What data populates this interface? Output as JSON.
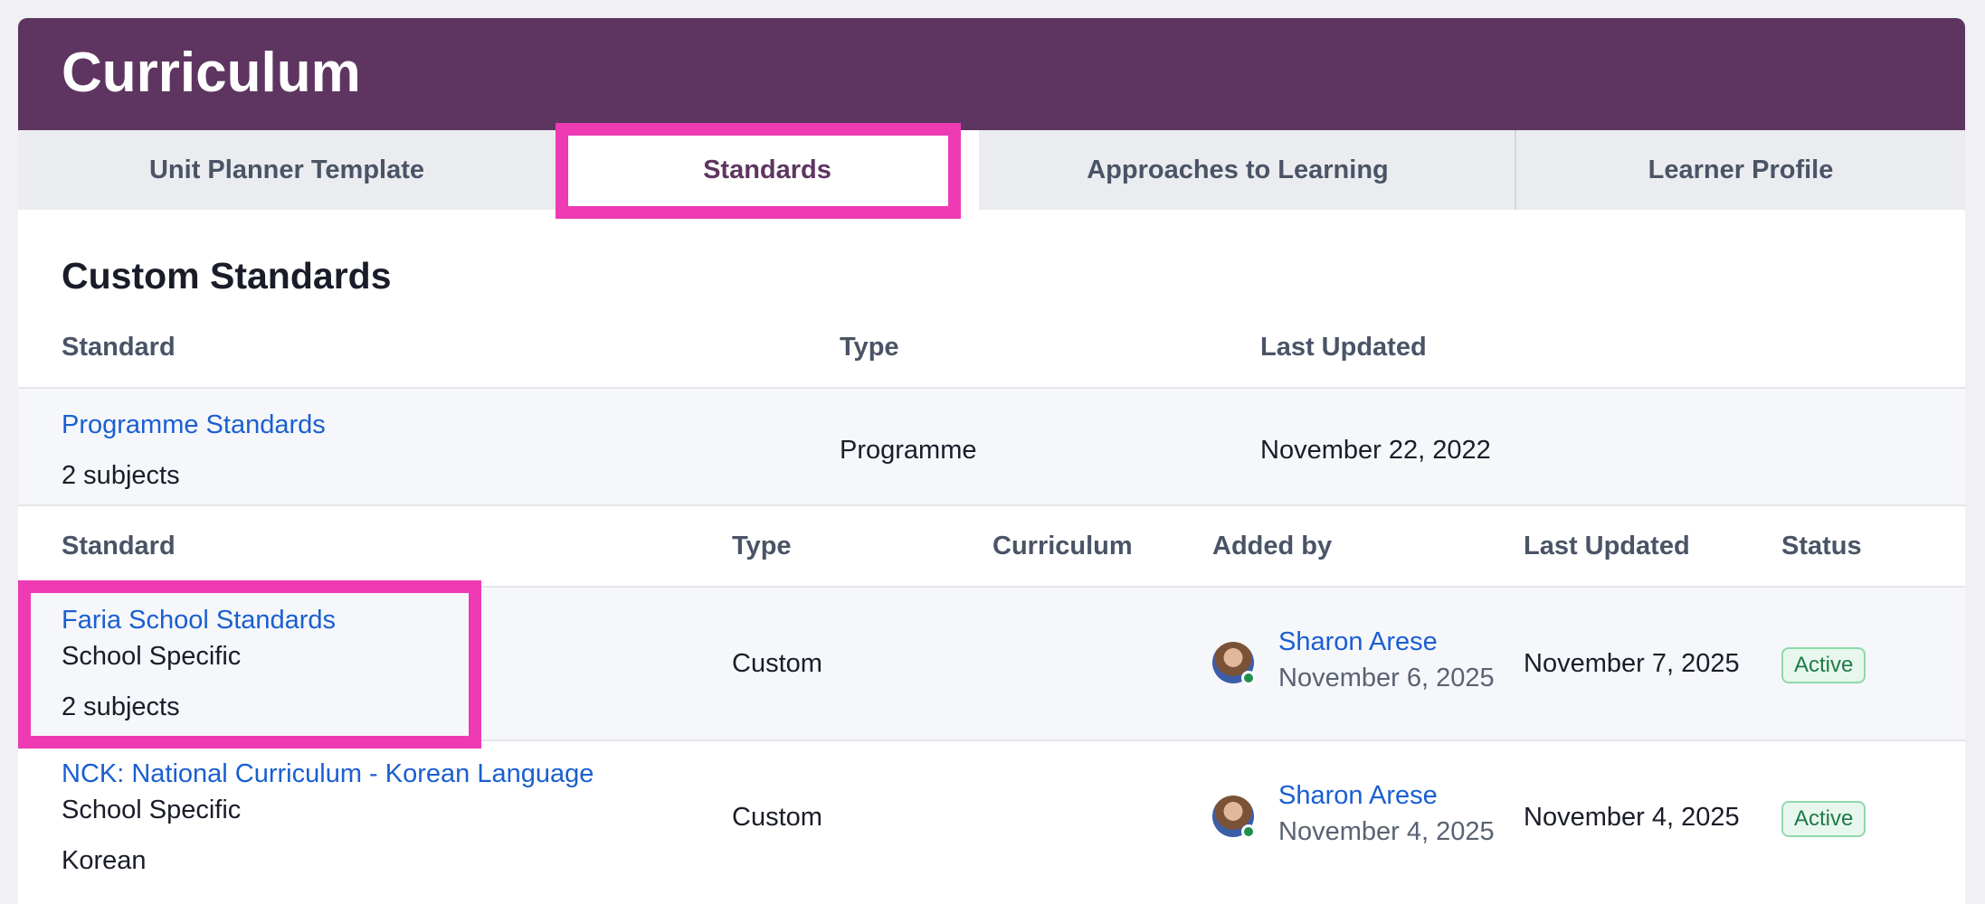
{
  "header": {
    "title": "Curriculum"
  },
  "tabs": [
    {
      "label": "Unit Planner Template"
    },
    {
      "label": "Standards"
    },
    {
      "label": "Approaches to Learning"
    },
    {
      "label": "Learner Profile"
    }
  ],
  "active_tab": "Standards",
  "custom_standards": {
    "title": "Custom Standards",
    "columns": {
      "standard": "Standard",
      "type": "Type",
      "last_updated": "Last Updated"
    },
    "rows": [
      {
        "name": "Programme Standards",
        "subjects": "2 subjects",
        "type": "Programme",
        "last_updated": "November 22, 2022"
      }
    ]
  },
  "standards_table": {
    "columns": {
      "standard": "Standard",
      "type": "Type",
      "curriculum": "Curriculum",
      "added_by": "Added by",
      "last_updated": "Last Updated",
      "status": "Status"
    },
    "rows": [
      {
        "name": "Faria School Standards",
        "category": "School Specific",
        "detail": "2 subjects",
        "type": "Custom",
        "curriculum": "",
        "added_by_name": "Sharon Arese",
        "added_by_date": "November 6, 2025",
        "last_updated": "November 7, 2025",
        "status": "Active"
      },
      {
        "name": "NCK: National Curriculum - Korean Language",
        "category": "School Specific",
        "detail": "Korean",
        "type": "Custom",
        "curriculum": "",
        "added_by_name": "Sharon Arese",
        "added_by_date": "November 4, 2025",
        "last_updated": "November 4, 2025",
        "status": "Active"
      }
    ]
  },
  "colors": {
    "brand": "#5e3561",
    "link": "#1a5fd0",
    "highlight": "#ee3ab3",
    "status_active": "#1f7a47"
  }
}
